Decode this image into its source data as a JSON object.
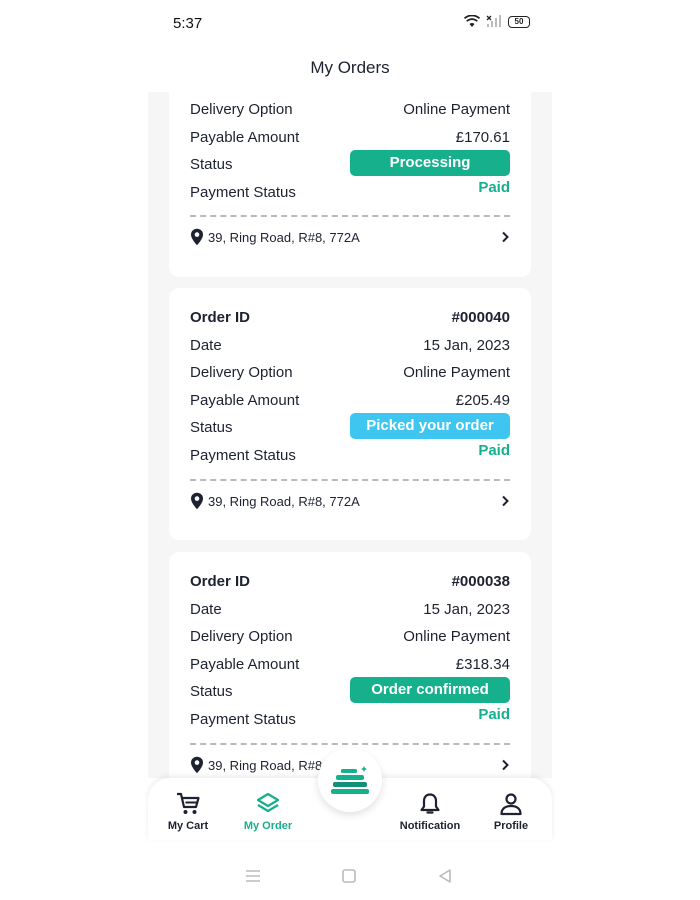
{
  "status_bar": {
    "time": "5:37",
    "battery": "50"
  },
  "header": {
    "title": "My Orders"
  },
  "partial_card": {
    "delivery_label": "Delivery Option",
    "delivery_value": "Online Payment",
    "amount_label": "Payable Amount",
    "amount_value": "£170.61",
    "status_label": "Status",
    "status_value": "Processing",
    "payment_label": "Payment Status",
    "payment_value": "Paid",
    "address": "39, Ring Road, R#8, 772A"
  },
  "orders": [
    {
      "id_label": "Order ID",
      "id": "#000040",
      "date_label": "Date",
      "date": "15 Jan, 2023",
      "delivery_label": "Delivery Option",
      "delivery": "Online Payment",
      "amount_label": "Payable Amount",
      "amount": "£205.49",
      "status_label": "Status",
      "status": "Picked your order",
      "payment_label": "Payment Status",
      "payment": "Paid",
      "address": "39, Ring Road, R#8, 772A"
    },
    {
      "id_label": "Order ID",
      "id": "#000038",
      "date_label": "Date",
      "date": "15 Jan, 2023",
      "delivery_label": "Delivery Option",
      "delivery": "Online Payment",
      "amount_label": "Payable Amount",
      "amount": "£318.34",
      "status_label": "Status",
      "status": "Order confirmed",
      "payment_label": "Payment Status",
      "payment": "Paid",
      "address": "39, Ring Road, R#8"
    }
  ],
  "nav": {
    "cart": "My Cart",
    "order": "My Order",
    "notification": "Notification",
    "profile": "Profile"
  },
  "colors": {
    "accent_green": "#17b08c",
    "status_processing": "#17b08c",
    "status_picked": "#3fc6f0",
    "status_confirmed": "#17b08c",
    "paid_text": "#17b08c",
    "dark_text": "#1c2230"
  },
  "icons": {
    "cart": "cart-icon",
    "order": "layers-icon",
    "center": "laundry-stack-icon",
    "notification": "bell-icon",
    "profile": "person-icon",
    "location": "location-pin-icon",
    "chevron": "chevron-right-icon"
  }
}
